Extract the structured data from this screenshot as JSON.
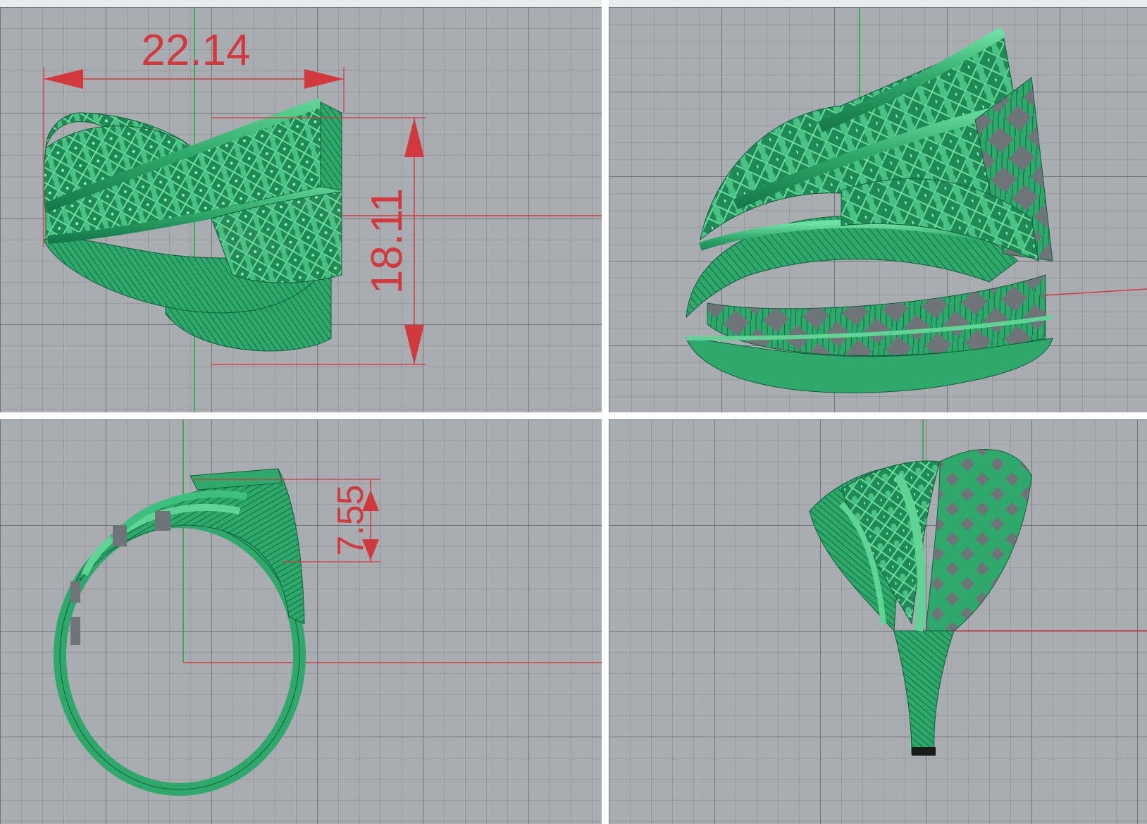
{
  "layout": "four-viewport",
  "colors": {
    "viewport_bg": "#a9adb1",
    "grid_line": "#7d8188",
    "model": "#2fa86b",
    "model_light": "#5fd494",
    "model_dark": "#0f5e3a",
    "dimension": "#d2393c",
    "axis_x": "#d03a3a",
    "axis_y": "#23a33a"
  },
  "viewports": [
    {
      "id": "top-left",
      "view": "front",
      "dimensions": [
        {
          "label": "width",
          "value": "22.14"
        },
        {
          "label": "height",
          "value": "18.11"
        }
      ]
    },
    {
      "id": "top-right",
      "view": "perspective",
      "dimensions": []
    },
    {
      "id": "bottom-left",
      "view": "side",
      "dimensions": [
        {
          "label": "top-thickness",
          "value": "7.55"
        }
      ]
    },
    {
      "id": "bottom-right",
      "view": "top",
      "dimensions": []
    }
  ]
}
